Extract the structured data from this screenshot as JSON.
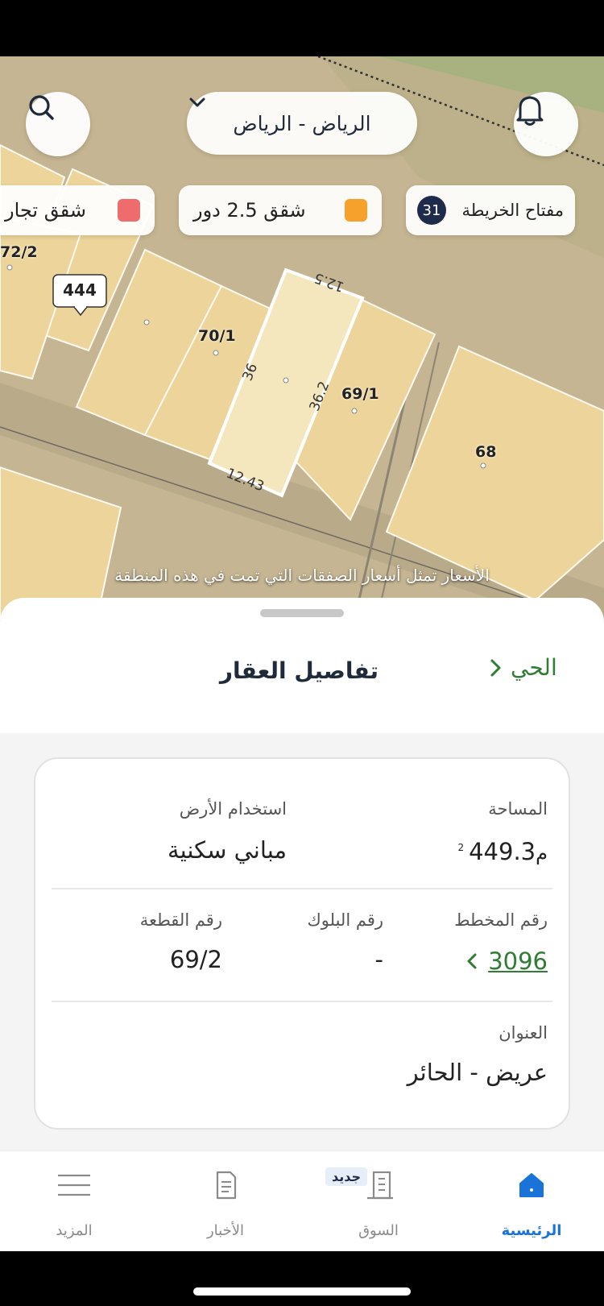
{
  "header": {
    "location": "الرياض - الرياض",
    "search_icon": "search-icon",
    "bell_icon": "bell-icon"
  },
  "legend": {
    "map_key_label": "مفتاح الخريطة",
    "map_key_count": "31",
    "items": [
      {
        "label": "شقق 2.5 دور",
        "color": "#f5a12b"
      },
      {
        "label": "شقق تجار",
        "color": "#f06b6b"
      }
    ]
  },
  "map": {
    "parcels": {
      "p444": "444",
      "p70": "70/1",
      "p69": "69/1",
      "p68": "68",
      "p72": "72/2"
    },
    "dims": {
      "top": "12.5",
      "left": "36",
      "right": "36.2",
      "bottom": "12.43"
    },
    "caption": "الأسعار تمثل أسعار الصفقات التي تمت في هذه المنطقة"
  },
  "sheet": {
    "title": "تفاصيل العقار",
    "back_label": "الحي",
    "fields": {
      "area_label": "المساحة",
      "area_value": "449.3",
      "area_unit": "م",
      "area_sup": "2",
      "land_use_label": "استخدام الأرض",
      "land_use_value": "مباني سكنية",
      "plan_label": "رقم المخطط",
      "plan_value": "3096",
      "block_label": "رقم البلوك",
      "block_value": "-",
      "plot_label": "رقم القطعة",
      "plot_value": "69/2",
      "address_label": "العنوان",
      "address_value": "عريض - الحائر"
    }
  },
  "nav": {
    "items": [
      {
        "label": "الرئيسية",
        "icon": "home-icon",
        "active": true
      },
      {
        "label": "السوق",
        "icon": "market-building-icon",
        "badge": "جديد"
      },
      {
        "label": "الأخبار",
        "icon": "news-document-icon"
      },
      {
        "label": "المزيد",
        "icon": "menu-lines-icon"
      }
    ]
  },
  "colors": {
    "accent_green": "#2e7d32",
    "nav_active": "#1a73d9",
    "parcel_fill": "#ecd49a",
    "selected_fill": "#f5e7bd"
  }
}
